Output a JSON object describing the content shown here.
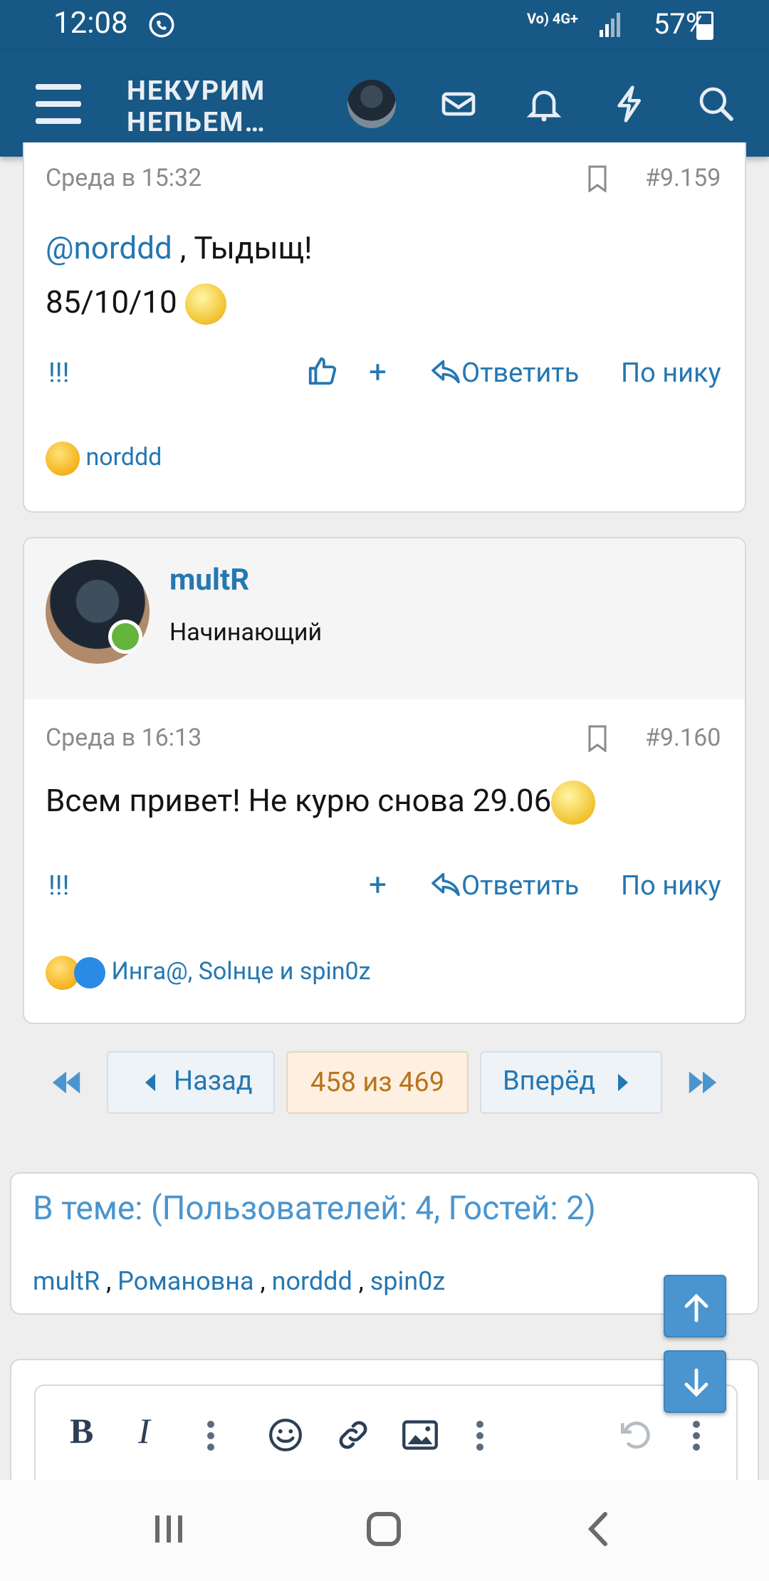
{
  "status": {
    "time": "12:08",
    "signal_text": "Vo) 4G+",
    "battery": "57%"
  },
  "header": {
    "logo_line1": "НЕКУРИМ",
    "logo_line2": "НЕПЬЕМ…"
  },
  "post1": {
    "time": "Среда в 15:32",
    "number": "#9.159",
    "mention": "@norddd",
    "text_after_mention": " , Тыдыщ!",
    "line2": "85/10/10",
    "report": "!!!",
    "reply": "Ответить",
    "by_nick": "По нику",
    "plus": "+",
    "reactions": "norddd"
  },
  "post2": {
    "username": "multR",
    "user_title": "Начинающий",
    "time": "Среда в 16:13",
    "number": "#9.160",
    "text": "Всем привет! Не курю снова 29.06",
    "report": "!!!",
    "reply": "Ответить",
    "by_nick": "По нику",
    "plus": "+",
    "reactions": "Инга@, Solнце и spin0z"
  },
  "pagination": {
    "prev": "Назад",
    "current": "458 из 469",
    "next": "Вперёд"
  },
  "online": {
    "title": "В теме: (Пользователей: 4, Гостей: 2)",
    "users": [
      "multR",
      "Романовна",
      "norddd",
      "spin0z"
    ]
  },
  "colors": {
    "brand": "#185886",
    "link": "#2577b1",
    "online": "#63b53c"
  }
}
